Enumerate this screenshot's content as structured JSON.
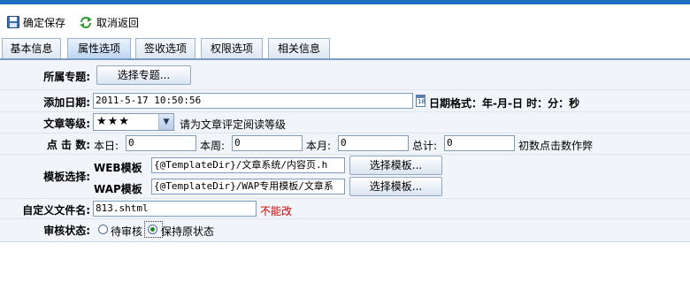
{
  "toolbar": {
    "save_label": "确定保存",
    "cancel_label": "取消返回"
  },
  "tabs": [
    {
      "label": "基本信息"
    },
    {
      "label": "属性选项"
    },
    {
      "label": "签收选项"
    },
    {
      "label": "权限选项"
    },
    {
      "label": "相关信息"
    }
  ],
  "form": {
    "topic": {
      "label": "所属专题:",
      "button": "选择专题..."
    },
    "date": {
      "label": "添加日期:",
      "value": "2011-5-17 10:50:56",
      "format_hint": "日期格式：年-月-日 时：分：秒"
    },
    "level": {
      "label": "文章等级:",
      "selected": "★★★",
      "hint": "请为文章评定阅读等级"
    },
    "clicks": {
      "label": "点 击 数:",
      "day_label": "本日:",
      "day_value": "0",
      "week_label": "本周:",
      "week_value": "0",
      "month_label": "本月:",
      "month_value": "0",
      "total_label": "总计:",
      "total_value": "0",
      "hint": "初数点击数作弊"
    },
    "template": {
      "label": "模板选择:",
      "web_label": "WEB模板",
      "web_value": "{@TemplateDir}/文章系统/内容页.h",
      "wap_label": "WAP模板",
      "wap_value": "{@TemplateDir}/WAP专用模板/文章系",
      "button": "选择模板..."
    },
    "filename": {
      "label": "自定义文件名:",
      "value": "813.shtml",
      "note": "不能改"
    },
    "audit": {
      "label": "审核状态:",
      "option_pending": "待审核",
      "option_keep": "保持原状态",
      "selected": "保持原状态"
    }
  },
  "colors": {
    "accent": "#1f6fc0",
    "panel_bg": "#f1f5fa",
    "warning": "#d00000"
  },
  "icons": {
    "save": "save-disk-icon",
    "cancel": "refresh-arrows-icon",
    "calendar": "calendar-icon",
    "dropdown": "chevron-down-icon"
  }
}
